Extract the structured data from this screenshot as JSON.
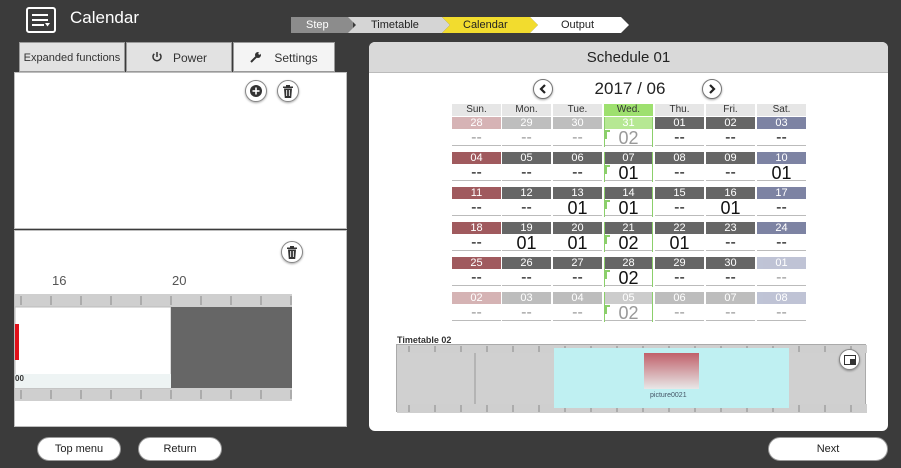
{
  "app": {
    "title": "Calendar"
  },
  "steps": [
    {
      "label": "Step",
      "state": "header"
    },
    {
      "label": "Timetable",
      "state": "done"
    },
    {
      "label": "Calendar",
      "state": "current"
    },
    {
      "label": "Output",
      "state": "pending"
    }
  ],
  "left": {
    "tabs": [
      {
        "label": "Expanded functions",
        "icon": ""
      },
      {
        "label": "Power",
        "icon": "power-icon"
      },
      {
        "label": "Settings",
        "icon": "wrench-icon"
      }
    ],
    "hours": [
      "16",
      "20"
    ],
    "clip_fragment": "00"
  },
  "schedule": {
    "title": "Schedule 01",
    "month": "2017 / 06",
    "weekdays": [
      "Sun.",
      "Mon.",
      "Tue.",
      "Wed.",
      "Thu.",
      "Fri.",
      "Sat."
    ],
    "today_weekday_index": 3,
    "weeks": [
      [
        {
          "d": "28",
          "v": "--",
          "o": true
        },
        {
          "d": "29",
          "v": "--",
          "o": true
        },
        {
          "d": "30",
          "v": "--",
          "o": true
        },
        {
          "d": "31",
          "v": "02",
          "o": true
        },
        {
          "d": "01",
          "v": "--"
        },
        {
          "d": "02",
          "v": "--"
        },
        {
          "d": "03",
          "v": "--"
        }
      ],
      [
        {
          "d": "04",
          "v": "--"
        },
        {
          "d": "05",
          "v": "--"
        },
        {
          "d": "06",
          "v": "--"
        },
        {
          "d": "07",
          "v": "01"
        },
        {
          "d": "08",
          "v": "--"
        },
        {
          "d": "09",
          "v": "--"
        },
        {
          "d": "10",
          "v": "01"
        }
      ],
      [
        {
          "d": "11",
          "v": "--"
        },
        {
          "d": "12",
          "v": "--"
        },
        {
          "d": "13",
          "v": "01"
        },
        {
          "d": "14",
          "v": "01"
        },
        {
          "d": "15",
          "v": "--"
        },
        {
          "d": "16",
          "v": "01"
        },
        {
          "d": "17",
          "v": "--"
        }
      ],
      [
        {
          "d": "18",
          "v": "--"
        },
        {
          "d": "19",
          "v": "01"
        },
        {
          "d": "20",
          "v": "01"
        },
        {
          "d": "21",
          "v": "02"
        },
        {
          "d": "22",
          "v": "01"
        },
        {
          "d": "23",
          "v": "--"
        },
        {
          "d": "24",
          "v": "--"
        }
      ],
      [
        {
          "d": "25",
          "v": "--"
        },
        {
          "d": "26",
          "v": "--"
        },
        {
          "d": "27",
          "v": "--"
        },
        {
          "d": "28",
          "v": "02"
        },
        {
          "d": "29",
          "v": "--"
        },
        {
          "d": "30",
          "v": "--"
        },
        {
          "d": "01",
          "v": "--",
          "o": true
        }
      ],
      [
        {
          "d": "02",
          "v": "--",
          "o": true
        },
        {
          "d": "03",
          "v": "--",
          "o": true
        },
        {
          "d": "04",
          "v": "--",
          "o": true
        },
        {
          "d": "05",
          "v": "02",
          "o": true
        },
        {
          "d": "06",
          "v": "--",
          "o": true
        },
        {
          "d": "07",
          "v": "--",
          "o": true
        },
        {
          "d": "08",
          "v": "--",
          "o": true
        }
      ]
    ],
    "timetable_label": "Timetable 02",
    "clip_label": "picture0021"
  },
  "colors": {
    "sunday": "#a05a5e",
    "saturday": "#7d83a3",
    "weekday": "#666666",
    "today": "#9ee06f",
    "accent_yellow": "#f2dc2e",
    "timetable_block": "#bff0f2",
    "timetable_dark": "#666666"
  },
  "buttons": {
    "top_menu": "Top menu",
    "return": "Return",
    "next": "Next"
  }
}
